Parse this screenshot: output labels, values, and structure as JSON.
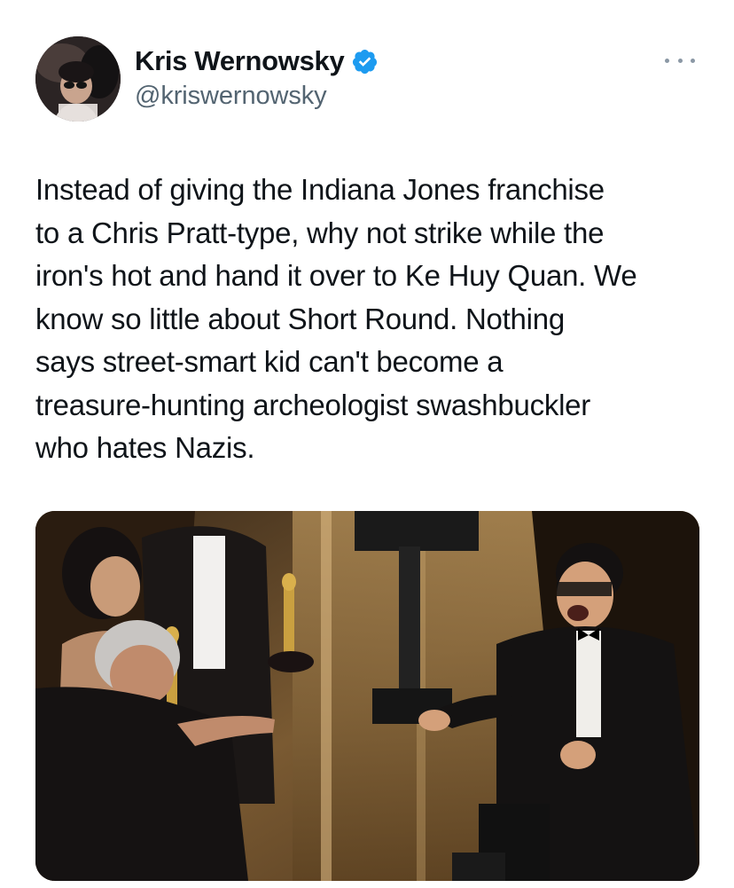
{
  "author": {
    "display_name": "Kris Wernowsky",
    "handle": "@kriswernowsky",
    "verified": true,
    "verified_color": "#1d9bf0"
  },
  "icons": {
    "verified": "verified-badge-icon",
    "more": "more-options-icon"
  },
  "tweet": {
    "text": "Instead of giving the Indiana Jones franchise\nto a Chris Pratt-type, why not strike while the\niron's hot and hand it over to Ke Huy Quan. We\nknow so little about Short Round. Nothing\nsays street-smart kid can't become a\ntreasure-hunting archeologist swashbuckler\nwho hates Nazis."
  },
  "media": {
    "kind": "photo"
  }
}
